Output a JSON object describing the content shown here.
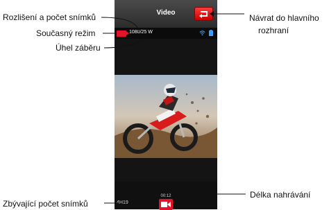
{
  "screen": {
    "title": "Video",
    "resolution_framerate": "1080/25 W",
    "recording_time": "00:12",
    "remaining_shots": "4H19"
  },
  "annotations": {
    "resolution_label": "Rozlišení a počet snímků",
    "current_mode_label": "Současný režim",
    "view_angle_label": "Úhel záběru",
    "back_label_line1": "Návrat do hlavního",
    "back_label_line2": "rozhraní",
    "recording_time_label": "Délka nahrávání",
    "remaining_shots_label": "Zbývající počet snímků"
  },
  "icons": {
    "mode": "video-camera-icon",
    "wifi": "wifi-icon",
    "battery": "battery-icon",
    "back": "back-arrow-icon",
    "record": "record-video-icon"
  },
  "colors": {
    "accent": "#e4122a",
    "bar": "#2c2c2c"
  }
}
